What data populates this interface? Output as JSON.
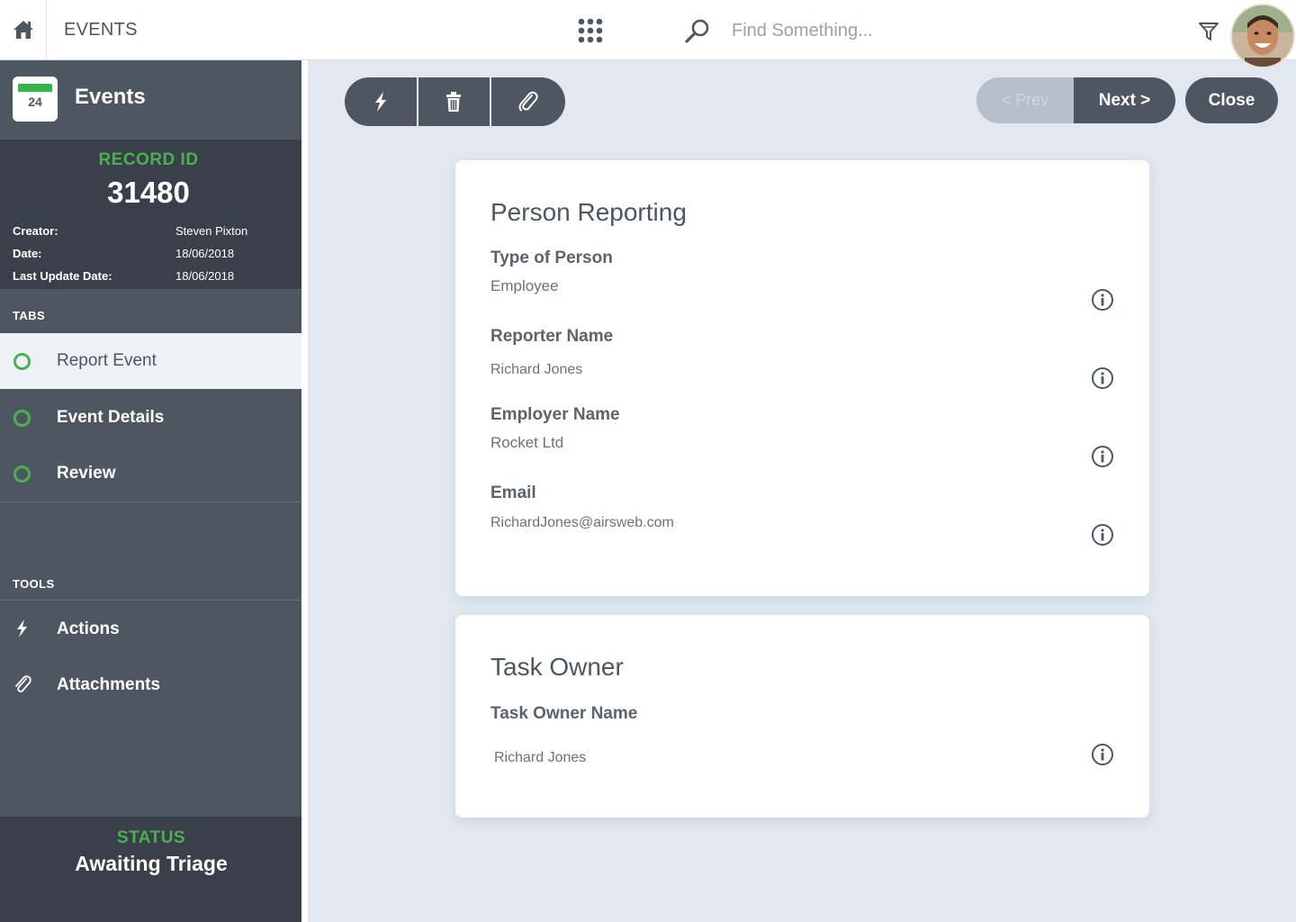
{
  "header": {
    "app_title": "EVENTS",
    "search_placeholder": "Find Something..."
  },
  "sidebar": {
    "module_title": "Events",
    "calendar_day": "24",
    "record": {
      "label": "RECORD ID",
      "id": "31480",
      "meta": [
        {
          "key": "Creator:",
          "value": "Steven Pixton"
        },
        {
          "key": "Date:",
          "value": "18/06/2018"
        },
        {
          "key": "Last Update Date:",
          "value": "18/06/2018"
        }
      ]
    },
    "tabs_label": "TABS",
    "tabs": [
      {
        "label": "Report Event",
        "active": true
      },
      {
        "label": "Event Details",
        "active": false
      },
      {
        "label": "Review",
        "active": false
      }
    ],
    "tools_label": "TOOLS",
    "tools": [
      {
        "label": "Actions",
        "icon": "bolt-icon"
      },
      {
        "label": "Attachments",
        "icon": "paperclip-icon"
      }
    ],
    "status": {
      "label": "STATUS",
      "value": "Awaiting Triage"
    }
  },
  "toolbar": {
    "buttons": [
      "bolt-icon",
      "trash-icon",
      "paperclip-icon"
    ],
    "prev_label": "< Prev",
    "next_label": "Next >",
    "close_label": "Close"
  },
  "cards": {
    "person_reporting": {
      "title": "Person Reporting",
      "fields": [
        {
          "label": "Type of Person",
          "value": "Employee"
        },
        {
          "label": "Reporter Name",
          "value": "Richard Jones"
        },
        {
          "label": "Employer Name",
          "value": "Rocket Ltd"
        },
        {
          "label": "Email",
          "value": "RichardJones@airsweb.com"
        }
      ]
    },
    "task_owner": {
      "title": "Task Owner",
      "fields": [
        {
          "label": "Task Owner Name",
          "value": "Richard Jones"
        }
      ]
    }
  },
  "colors": {
    "accent_green": "#4cb050",
    "sidebar_dark": "#3a4049",
    "sidebar": "#4e5661",
    "background": "#e1e8f0"
  }
}
